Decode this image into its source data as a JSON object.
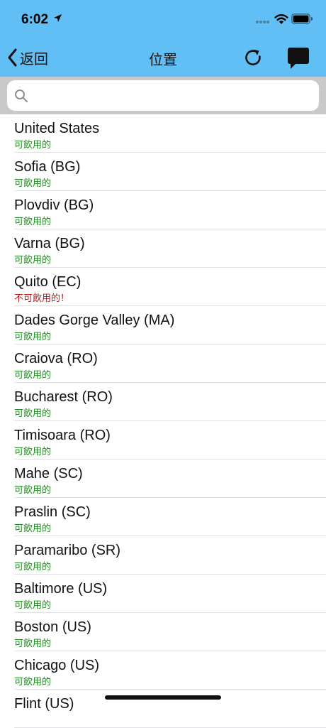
{
  "status_bar": {
    "time": "6:02"
  },
  "nav": {
    "back_label": "返回",
    "title": "位置"
  },
  "search": {
    "placeholder": ""
  },
  "colors": {
    "header": "#62bff5",
    "drinkable": "#1f8a1f",
    "not_drinkable": "#b71c1c"
  },
  "locations": [
    {
      "name": "United States",
      "status": "可飲用的",
      "drinkable": true
    },
    {
      "name": "Sofia (BG)",
      "status": "可飲用的",
      "drinkable": true
    },
    {
      "name": "Plovdiv (BG)",
      "status": "可飲用的",
      "drinkable": true
    },
    {
      "name": "Varna (BG)",
      "status": "可飲用的",
      "drinkable": true
    },
    {
      "name": "Quito (EC)",
      "status": "不可飲用的！",
      "drinkable": false
    },
    {
      "name": "Dades Gorge Valley (MA)",
      "status": "可飲用的",
      "drinkable": true
    },
    {
      "name": "Craiova (RO)",
      "status": "可飲用的",
      "drinkable": true
    },
    {
      "name": "Bucharest (RO)",
      "status": "可飲用的",
      "drinkable": true
    },
    {
      "name": "Timisoara (RO)",
      "status": "可飲用的",
      "drinkable": true
    },
    {
      "name": "Mahe (SC)",
      "status": "可飲用的",
      "drinkable": true
    },
    {
      "name": "Praslin (SC)",
      "status": "可飲用的",
      "drinkable": true
    },
    {
      "name": "Paramaribo (SR)",
      "status": "可飲用的",
      "drinkable": true
    },
    {
      "name": "Baltimore (US)",
      "status": "可飲用的",
      "drinkable": true
    },
    {
      "name": "Boston (US)",
      "status": "可飲用的",
      "drinkable": true
    },
    {
      "name": "Chicago (US)",
      "status": "可飲用的",
      "drinkable": true
    },
    {
      "name": "Flint (US)",
      "status": "",
      "drinkable": true
    }
  ]
}
